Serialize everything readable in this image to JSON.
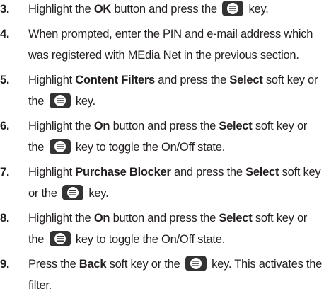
{
  "steps": [
    {
      "num": "3.",
      "l1a": "Highlight the ",
      "l1b": "OK",
      "l1c": " button and press the ",
      "l1d": " key.",
      "key_icon": "envelope-key-icon"
    },
    {
      "num": "4.",
      "l1": "When prompted, enter the PIN and e-mail address which",
      "l2": "was registered with MEdia Net in the previous section."
    },
    {
      "num": "5.",
      "l1a": "Highlight ",
      "l1b": "Content Filters",
      "l1c": " and press the ",
      "l1d": "Select",
      "l1e": " soft key or",
      "l2a": "the ",
      "l2b": " key.",
      "key_icon": "envelope-key-icon"
    },
    {
      "num": "6.",
      "l1a": "Highlight the ",
      "l1b": "On",
      "l1c": " button and press the ",
      "l1d": "Select",
      "l1e": " soft key or",
      "l2a": "the ",
      "l2b": " key to toggle the On/Off state.",
      "key_icon": "envelope-key-icon"
    },
    {
      "num": "7.",
      "l1a": "Highlight ",
      "l1b": "Purchase Blocker",
      "l1c": " and press the ",
      "l1d": "Select",
      "l1e": " soft key",
      "l2a": "or the ",
      "l2b": " key.",
      "key_icon": "envelope-key-icon"
    },
    {
      "num": "8.",
      "l1a": "Highlight the ",
      "l1b": "On",
      "l1c": " button and press the ",
      "l1d": "Select",
      "l1e": " soft key or",
      "l2a": "the ",
      "l2b": " key to toggle the On/Off state.",
      "key_icon": "envelope-key-icon"
    },
    {
      "num": "9.",
      "l1a": "Press the ",
      "l1b": "Back",
      "l1c": " soft key or the ",
      "l1d": " key. This activates the",
      "l2": "filter.",
      "key_icon": "envelope-key-icon"
    }
  ]
}
